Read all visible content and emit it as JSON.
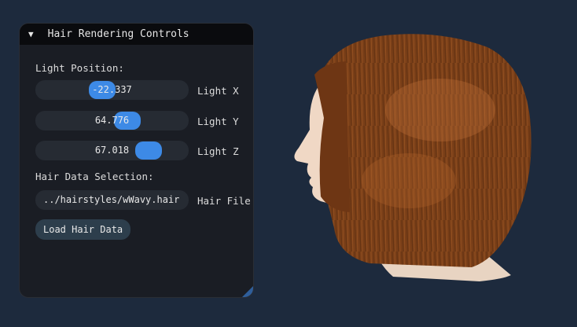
{
  "panel": {
    "title": "Hair Rendering Controls",
    "light_section_label": "Light Position:",
    "sliders": [
      {
        "name": "Light X",
        "value": "-22.337",
        "fraction": 0.42
      },
      {
        "name": "Light Y",
        "value": "64.776",
        "fraction": 0.62
      },
      {
        "name": "Light Z",
        "value": "67.018",
        "fraction": 0.79
      }
    ],
    "hair_section_label": "Hair Data Selection:",
    "hair_file": {
      "value": "../hairstyles/wWavy.hair",
      "label": "Hair File"
    },
    "load_button": "Load Hair Data"
  },
  "colors": {
    "background": "#1d2a3d",
    "accent": "#3d8ae6",
    "hair": "#8a4a1e",
    "skin": "#f2d3bc"
  }
}
